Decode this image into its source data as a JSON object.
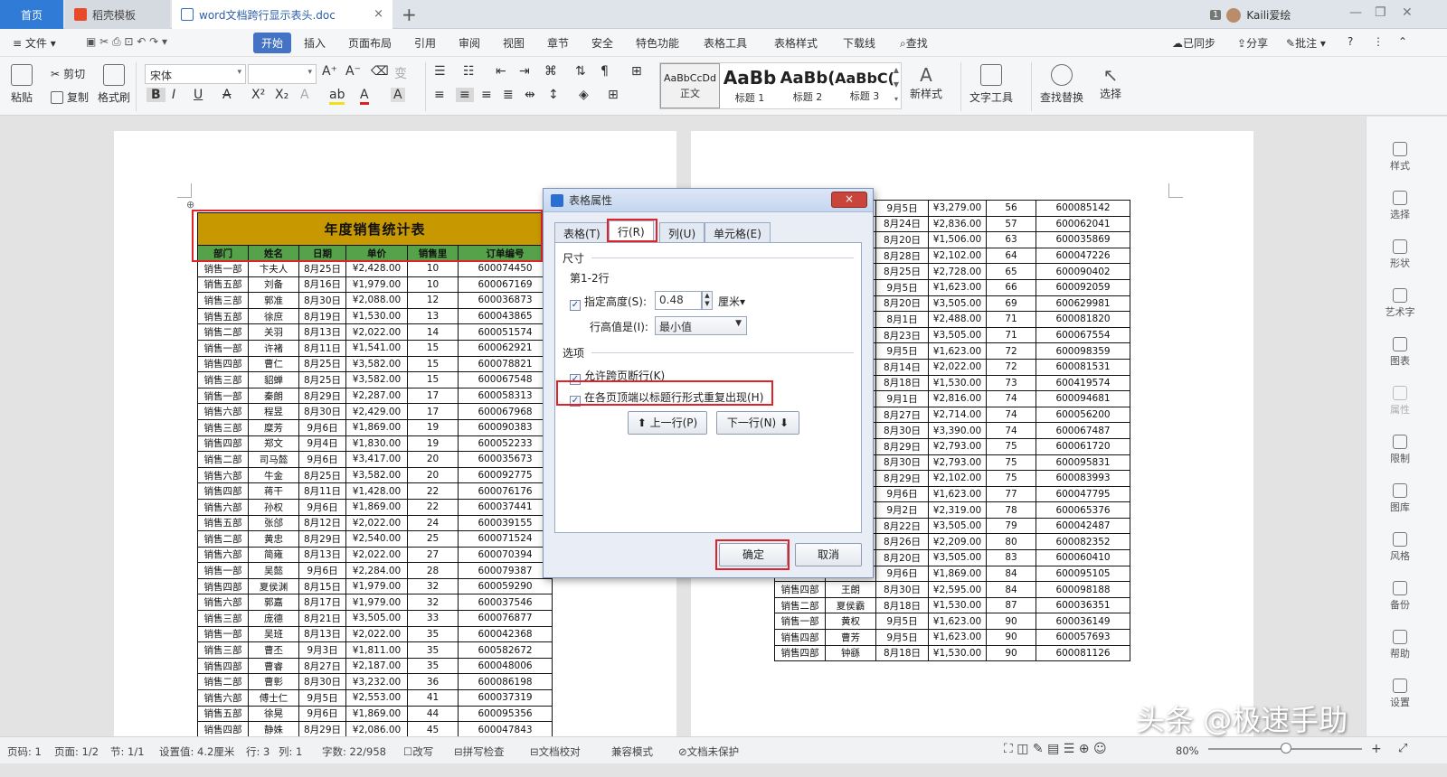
{
  "titlebar": {
    "tabs": [
      {
        "label": "首页"
      },
      {
        "label": "稻壳模板"
      },
      {
        "label": "word文档跨行显示表头.doc"
      }
    ],
    "plus": "+",
    "user_badge": "1",
    "user_name": "Kaili爱绘",
    "close": "×"
  },
  "menubar": {
    "file": "文件",
    "items": [
      "开始",
      "插入",
      "页面布局",
      "引用",
      "审阅",
      "视图",
      "章节",
      "安全",
      "特色功能",
      "表格工具",
      "表格样式",
      "下载线",
      "查找"
    ],
    "right": [
      "已同步",
      "分享",
      "批注",
      "?"
    ]
  },
  "ribbon": {
    "paste": "粘贴",
    "cut": "剪切",
    "copy": "复制",
    "format_painter": "格式刷",
    "font_name": "宋体",
    "font_size": "",
    "styles": [
      {
        "preview": "AaBbCcDd",
        "label": "正文"
      },
      {
        "preview": "AaBb",
        "label": "标题 1"
      },
      {
        "preview": "AaBb(",
        "label": "标题 2"
      },
      {
        "preview": "AaBbC(",
        "label": "标题 3"
      }
    ],
    "new_style": "新样式",
    "text_tools": "文字工具",
    "find_replace": "查找替换",
    "select": "选择"
  },
  "table1": {
    "title": "年度销售统计表",
    "headers": [
      "部门",
      "姓名",
      "日期",
      "单价",
      "销售里",
      "订单编号"
    ],
    "rows": [
      [
        "销售一部",
        "卞夫人",
        "8月25日",
        "¥2,428.00",
        "10",
        "600074450"
      ],
      [
        "销售五部",
        "刘备",
        "8月16日",
        "¥1,979.00",
        "10",
        "600067169"
      ],
      [
        "销售三部",
        "郭准",
        "8月30日",
        "¥2,088.00",
        "12",
        "600036873"
      ],
      [
        "销售五部",
        "徐庶",
        "8月19日",
        "¥1,530.00",
        "13",
        "600043865"
      ],
      [
        "销售二部",
        "关羽",
        "8月13日",
        "¥2,022.00",
        "14",
        "600051574"
      ],
      [
        "销售一部",
        "许褚",
        "8月11日",
        "¥1,541.00",
        "15",
        "600062921"
      ],
      [
        "销售四部",
        "曹仁",
        "8月25日",
        "¥3,582.00",
        "15",
        "600078821"
      ],
      [
        "销售三部",
        "貂蝉",
        "8月25日",
        "¥3,582.00",
        "15",
        "600067548"
      ],
      [
        "销售一部",
        "秦朗",
        "8月29日",
        "¥2,287.00",
        "17",
        "600058313"
      ],
      [
        "销售六部",
        "程昱",
        "8月30日",
        "¥2,429.00",
        "17",
        "600067968"
      ],
      [
        "销售三部",
        "糜芳",
        "9月6日",
        "¥1,869.00",
        "19",
        "600090383"
      ],
      [
        "销售四部",
        "郑文",
        "9月4日",
        "¥1,830.00",
        "19",
        "600052233"
      ],
      [
        "销售二部",
        "司马懿",
        "9月6日",
        "¥3,417.00",
        "20",
        "600035673"
      ],
      [
        "销售六部",
        "牛金",
        "8月25日",
        "¥3,582.00",
        "20",
        "600092775"
      ],
      [
        "销售四部",
        "蒋干",
        "8月11日",
        "¥1,428.00",
        "22",
        "600076176"
      ],
      [
        "销售六部",
        "孙权",
        "9月6日",
        "¥1,869.00",
        "22",
        "600037441"
      ],
      [
        "销售五部",
        "张郃",
        "8月12日",
        "¥2,022.00",
        "24",
        "600039155"
      ],
      [
        "销售二部",
        "黄忠",
        "8月29日",
        "¥2,540.00",
        "25",
        "600071524"
      ],
      [
        "销售六部",
        "简雍",
        "8月13日",
        "¥2,022.00",
        "27",
        "600070394"
      ],
      [
        "销售一部",
        "吴懿",
        "9月6日",
        "¥2,284.00",
        "28",
        "600079387"
      ],
      [
        "销售四部",
        "夏侯渊",
        "8月15日",
        "¥1,979.00",
        "32",
        "600059290"
      ],
      [
        "销售六部",
        "郭嘉",
        "8月17日",
        "¥1,979.00",
        "32",
        "600037546"
      ],
      [
        "销售三部",
        "庞德",
        "8月21日",
        "¥3,505.00",
        "33",
        "600076877"
      ],
      [
        "销售一部",
        "吴班",
        "8月13日",
        "¥2,022.00",
        "35",
        "600042368"
      ],
      [
        "销售三部",
        "曹丕",
        "9月3日",
        "¥1,811.00",
        "35",
        "600582672"
      ],
      [
        "销售四部",
        "曹睿",
        "8月27日",
        "¥2,187.00",
        "35",
        "600048006"
      ],
      [
        "销售二部",
        "曹彰",
        "8月30日",
        "¥3,232.00",
        "36",
        "600086198"
      ],
      [
        "销售六部",
        "傅士仁",
        "9月5日",
        "¥2,553.00",
        "41",
        "600037319"
      ],
      [
        "销售五部",
        "徐晃",
        "9月6日",
        "¥1,869.00",
        "44",
        "600095356"
      ],
      [
        "销售四部",
        "静姝",
        "8月29日",
        "¥2,086.00",
        "45",
        "600047843"
      ]
    ]
  },
  "table2": {
    "rows": [
      [
        "",
        "",
        "9月5日",
        "¥3,279.00",
        "56",
        "600085142"
      ],
      [
        "",
        "",
        "8月24日",
        "¥2,836.00",
        "57",
        "600062041"
      ],
      [
        "",
        "",
        "8月20日",
        "¥1,506.00",
        "63",
        "600035869"
      ],
      [
        "",
        "",
        "8月28日",
        "¥2,102.00",
        "64",
        "600047226"
      ],
      [
        "",
        "",
        "8月25日",
        "¥2,728.00",
        "65",
        "600090402"
      ],
      [
        "",
        "",
        "9月5日",
        "¥1,623.00",
        "66",
        "600092059"
      ],
      [
        "",
        "",
        "8月20日",
        "¥3,505.00",
        "69",
        "600629981"
      ],
      [
        "",
        "",
        "8月1日",
        "¥2,488.00",
        "71",
        "600081820"
      ],
      [
        "",
        "",
        "8月23日",
        "¥3,505.00",
        "71",
        "600067554"
      ],
      [
        "",
        "",
        "9月5日",
        "¥1,623.00",
        "72",
        "600098359"
      ],
      [
        "",
        "",
        "8月14日",
        "¥2,022.00",
        "72",
        "600081531"
      ],
      [
        "",
        "",
        "8月18日",
        "¥1,530.00",
        "73",
        "600419574"
      ],
      [
        "",
        "",
        "9月1日",
        "¥2,816.00",
        "74",
        "600094681"
      ],
      [
        "",
        "",
        "8月27日",
        "¥2,714.00",
        "74",
        "600056200"
      ],
      [
        "",
        "",
        "8月30日",
        "¥3,390.00",
        "74",
        "600067487"
      ],
      [
        "",
        "",
        "8月29日",
        "¥2,793.00",
        "75",
        "600061720"
      ],
      [
        "",
        "",
        "8月30日",
        "¥2,793.00",
        "75",
        "600095831"
      ],
      [
        "",
        "",
        "8月29日",
        "¥2,102.00",
        "75",
        "600083993"
      ],
      [
        "",
        "",
        "9月6日",
        "¥1,623.00",
        "77",
        "600047795"
      ],
      [
        "",
        "",
        "9月2日",
        "¥2,319.00",
        "78",
        "600065376"
      ],
      [
        "",
        "",
        "8月22日",
        "¥3,505.00",
        "79",
        "600042487"
      ],
      [
        "",
        "",
        "8月26日",
        "¥2,209.00",
        "80",
        "600082352"
      ],
      [
        "",
        "",
        "8月20日",
        "¥3,505.00",
        "83",
        "600060410"
      ],
      [
        "",
        "",
        "9月6日",
        "¥1,869.00",
        "84",
        "600095105"
      ],
      [
        "销售四部",
        "王朗",
        "8月30日",
        "¥2,595.00",
        "84",
        "600098188"
      ],
      [
        "销售二部",
        "夏侯霸",
        "8月18日",
        "¥1,530.00",
        "87",
        "600036351"
      ],
      [
        "销售一部",
        "黄权",
        "9月5日",
        "¥1,623.00",
        "90",
        "600036149"
      ],
      [
        "销售四部",
        "曹芳",
        "9月5日",
        "¥1,623.00",
        "90",
        "600057693"
      ],
      [
        "销售四部",
        "钟繇",
        "8月18日",
        "¥1,530.00",
        "90",
        "600081126"
      ]
    ]
  },
  "dialog": {
    "title": "表格属性",
    "close": "×",
    "tabs": [
      "表格(T)",
      "行(R)",
      "列(U)",
      "单元格(E)"
    ],
    "size_label": "尺寸",
    "rows_label": "第1-2行",
    "specify_height": "指定高度(S):",
    "height_value": "0.48",
    "unit": "厘米",
    "row_height_is": "行高值是(I):",
    "row_height_mode": "最小值",
    "options_label": "选项",
    "allow_break": "允许跨页断行(K)",
    "repeat_header": "在各页顶端以标题行形式重复出现(H)",
    "prev_row": "上一行(P)",
    "next_row": "下一行(N)",
    "ok": "确定",
    "cancel": "取消"
  },
  "sidebar": [
    "样式",
    "选择",
    "形状",
    "艺术字",
    "图表",
    "属性",
    "限制",
    "图库",
    "风格",
    "备份",
    "帮助",
    "设置"
  ],
  "status": {
    "page_num": "页码: 1",
    "pages": "页面: 1/2",
    "section": "节: 1/1",
    "setting": "设置值: 4.2厘米",
    "row": "行: 3",
    "col": "列: 1",
    "words": "字数: 22/958",
    "revise": "改写",
    "spell": "拼写检查",
    "proof": "文档校对",
    "compat": "兼容模式",
    "protect": "文档未保护",
    "zoom": "80%",
    "minus": "−",
    "plus": "+"
  },
  "watermark": "头条 @极速手助",
  "colors": {
    "accent": "#2f7bd6",
    "table_title": "#c79800",
    "table_header": "#56a24a",
    "highlight": "#e0232b"
  }
}
